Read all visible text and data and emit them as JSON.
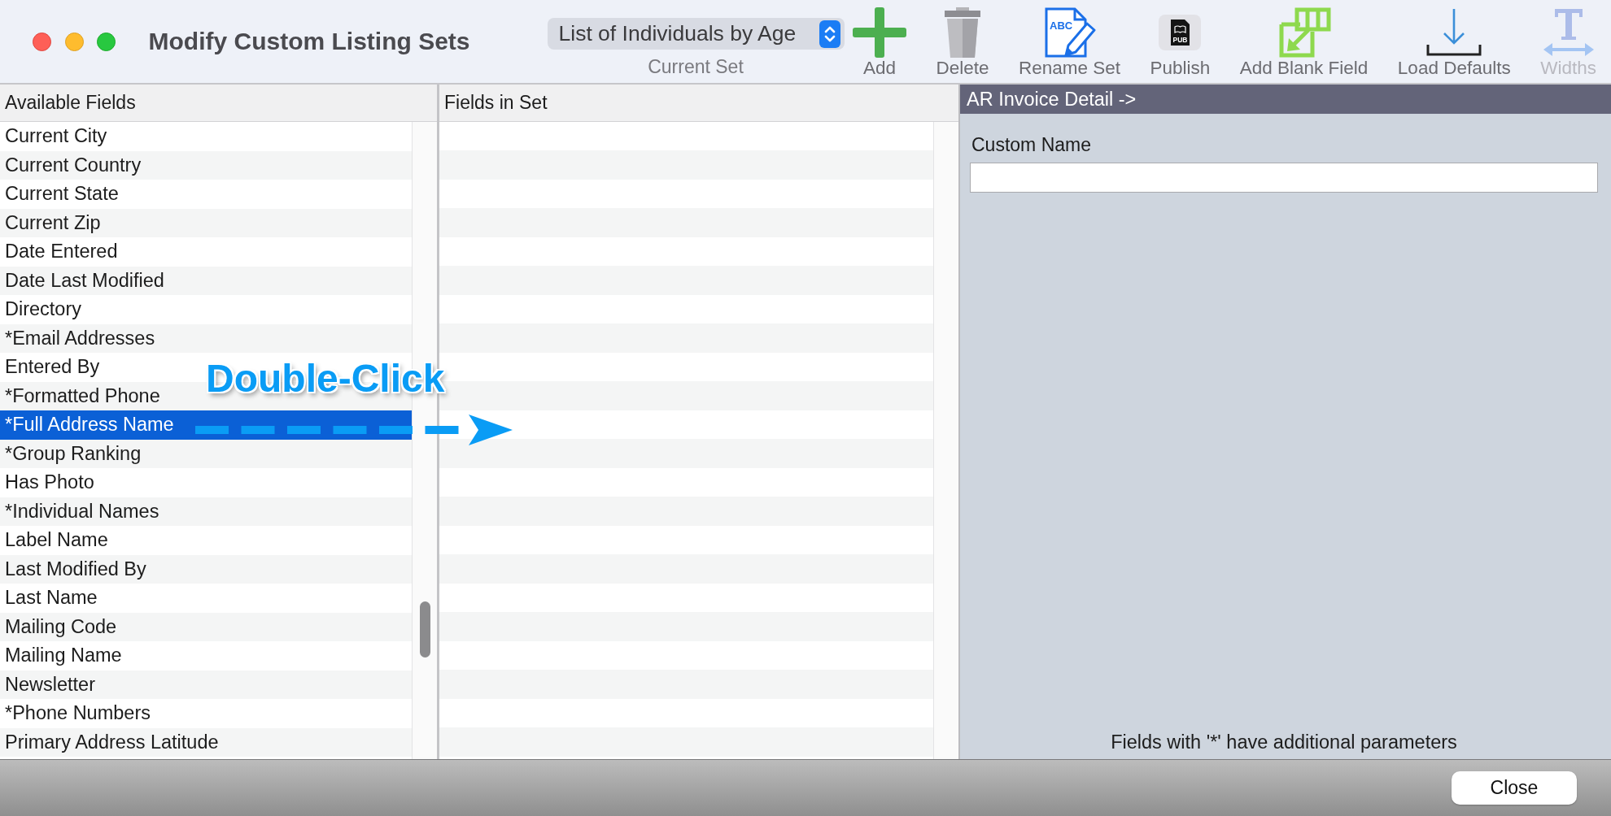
{
  "window": {
    "title": "Modify Custom Listing Sets"
  },
  "toolbar": {
    "current_set": {
      "value": "List of Individuals by Age",
      "caption": "Current Set"
    },
    "buttons": [
      {
        "kind": "add",
        "label": "Add",
        "disabled": false
      },
      {
        "kind": "delete",
        "label": "Delete",
        "disabled": false
      },
      {
        "kind": "rename",
        "label": "Rename Set",
        "icon_text": "ABC",
        "disabled": false
      },
      {
        "kind": "publish",
        "label": "Publish",
        "icon_text": "PUB",
        "disabled": false
      },
      {
        "kind": "add_blank",
        "label": "Add Blank Field",
        "disabled": false
      },
      {
        "kind": "load_defaults",
        "label": "Load Defaults",
        "disabled": false
      },
      {
        "kind": "widths",
        "label": "Widths",
        "disabled": true
      }
    ]
  },
  "available_fields": {
    "header": "Available Fields",
    "items": [
      {
        "label": "Current City",
        "selected": false
      },
      {
        "label": "Current Country",
        "selected": false
      },
      {
        "label": "Current State",
        "selected": false
      },
      {
        "label": "Current Zip",
        "selected": false
      },
      {
        "label": "Date Entered",
        "selected": false
      },
      {
        "label": "Date Last Modified",
        "selected": false
      },
      {
        "label": "Directory",
        "selected": false
      },
      {
        "label": "*Email Addresses",
        "selected": false
      },
      {
        "label": "Entered By",
        "selected": false
      },
      {
        "label": "*Formatted Phone",
        "selected": false
      },
      {
        "label": "*Full Address Name",
        "selected": true
      },
      {
        "label": "*Group Ranking",
        "selected": false
      },
      {
        "label": "Has Photo",
        "selected": false
      },
      {
        "label": "*Individual Names",
        "selected": false
      },
      {
        "label": "Label Name",
        "selected": false
      },
      {
        "label": "Last Modified By",
        "selected": false
      },
      {
        "label": "Last Name",
        "selected": false
      },
      {
        "label": "Mailing Code",
        "selected": false
      },
      {
        "label": "Mailing Name",
        "selected": false
      },
      {
        "label": "Newsletter",
        "selected": false
      },
      {
        "label": "*Phone Numbers",
        "selected": false
      },
      {
        "label": "Primary Address Latitude",
        "selected": false
      }
    ]
  },
  "fields_in_set": {
    "header": "Fields in Set"
  },
  "annotation": {
    "text": "Double-Click"
  },
  "detail_panel": {
    "title": "AR Invoice Detail ->",
    "custom_name_label": "Custom Name",
    "note": "Fields with '*' have additional parameters"
  },
  "footer": {
    "close_button": "Close"
  }
}
